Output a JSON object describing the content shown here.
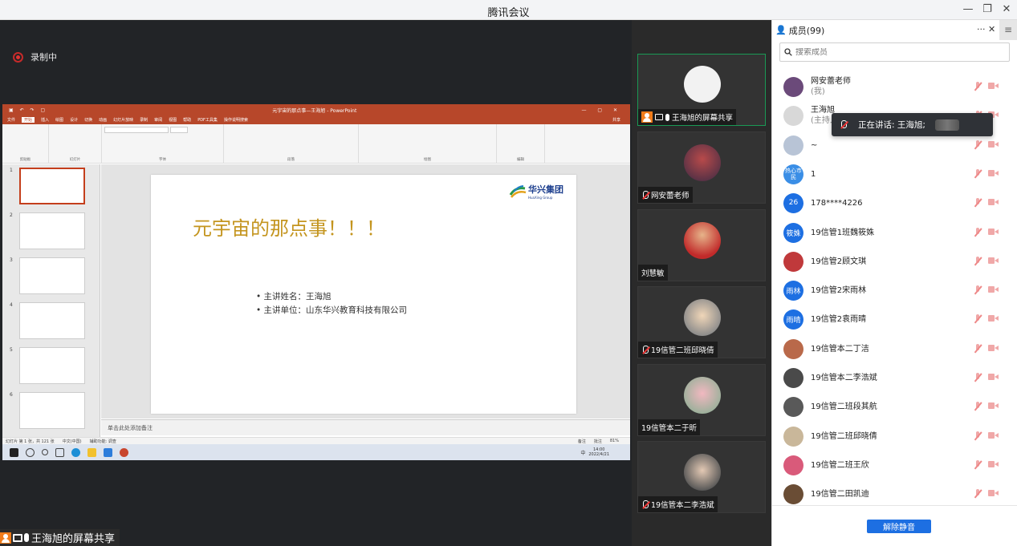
{
  "app": {
    "title": "腾讯会议"
  },
  "window_controls": {
    "minimize": "—",
    "restore": "❐",
    "close": "✕"
  },
  "recording": {
    "label": "录制中"
  },
  "share": {
    "label": "王海旭的屏幕共享"
  },
  "ppt": {
    "window_title": "元宇宙的那点事—王海旭 - PowerPoint",
    "menus": [
      "文件",
      "开始",
      "插入",
      "绘图",
      "设计",
      "切换",
      "动画",
      "幻灯片放映",
      "录制",
      "审阅",
      "视图",
      "帮助",
      "PDF工具集",
      "操作说明搜索"
    ],
    "active_menu": "开始",
    "share_btn": "共享",
    "ribbon_groups": [
      "剪贴板",
      "幻灯片",
      "字体",
      "段落",
      "绘图",
      "编辑"
    ],
    "thumb_numbers": [
      "1",
      "2",
      "3",
      "4",
      "5",
      "6"
    ],
    "slide": {
      "title": "元宇宙的那点事！！！",
      "bullets": [
        "主讲姓名：王海旭",
        "主讲单位：山东华兴教育科技有限公司"
      ],
      "logo_text": "华兴集团",
      "logo_sub": "HuaXing Group"
    },
    "notes_placeholder": "单击此处添加备注",
    "status": {
      "slide_count": "幻灯片 第 1 张，共 121 张",
      "language": "中文(中国)",
      "accessibility": "辅助功能: 调查",
      "notes": "备注",
      "comments": "批注",
      "zoom": "81%"
    },
    "taskbar": {
      "time": "14:00",
      "date": "2022/4/21",
      "ime": "中"
    }
  },
  "tiles": [
    {
      "label": "王海旭的屏幕共享",
      "type": "share"
    },
    {
      "label": "网安蕾老师",
      "type": "muted"
    },
    {
      "label": "刘慧敏",
      "type": "plain"
    },
    {
      "label": "19信管二班邱晓倩",
      "type": "muted"
    },
    {
      "label": "19信管本二于昕",
      "type": "plain"
    },
    {
      "label": "19信管本二李浩斌",
      "type": "muted"
    }
  ],
  "panel": {
    "title": "成员(99)",
    "more": "···",
    "close": "✕",
    "menu": "≡",
    "search_placeholder": "搜索成员",
    "speaking": "正在讲话: 王海旭;",
    "unmute": "解除静音",
    "members": [
      {
        "name": "网安蕾老师",
        "sub": "(我)",
        "avatar_text": "",
        "avatar_color": "#6b4a7a"
      },
      {
        "name": "王海旭",
        "sub": "(主持人)",
        "avatar_text": "",
        "avatar_color": "#d8d8d8"
      },
      {
        "name": "~",
        "sub": "",
        "avatar_text": "",
        "avatar_color": "#b8c4d6"
      },
      {
        "name": "1",
        "sub": "",
        "avatar_text": "热心市民",
        "avatar_color": "#3a8ee6"
      },
      {
        "name": "178****4226",
        "sub": "",
        "avatar_text": "26",
        "avatar_color": "#1d6fe2"
      },
      {
        "name": "19信管1班魏筱姝",
        "sub": "",
        "avatar_text": "筱姝",
        "avatar_color": "#1d6fe2"
      },
      {
        "name": "19信管2顾文琪",
        "sub": "",
        "avatar_text": "",
        "avatar_color": "#c0393b"
      },
      {
        "name": "19信管2宋雨林",
        "sub": "",
        "avatar_text": "雨林",
        "avatar_color": "#1d6fe2"
      },
      {
        "name": "19信管2袁雨晴",
        "sub": "",
        "avatar_text": "雨晴",
        "avatar_color": "#1d6fe2"
      },
      {
        "name": "19信管本二丁洁",
        "sub": "",
        "avatar_text": "",
        "avatar_color": "#b9694a"
      },
      {
        "name": "19信管本二李浩斌",
        "sub": "",
        "avatar_text": "",
        "avatar_color": "#4a4a4a"
      },
      {
        "name": "19信管二班段其航",
        "sub": "",
        "avatar_text": "",
        "avatar_color": "#595959"
      },
      {
        "name": "19信管二班邱晓倩",
        "sub": "",
        "avatar_text": "",
        "avatar_color": "#c9b79a"
      },
      {
        "name": "19信管二班王欣",
        "sub": "",
        "avatar_text": "",
        "avatar_color": "#d95a7a"
      },
      {
        "name": "19信管二田凯迪",
        "sub": "",
        "avatar_text": "",
        "avatar_color": "#6a4d35"
      }
    ]
  }
}
